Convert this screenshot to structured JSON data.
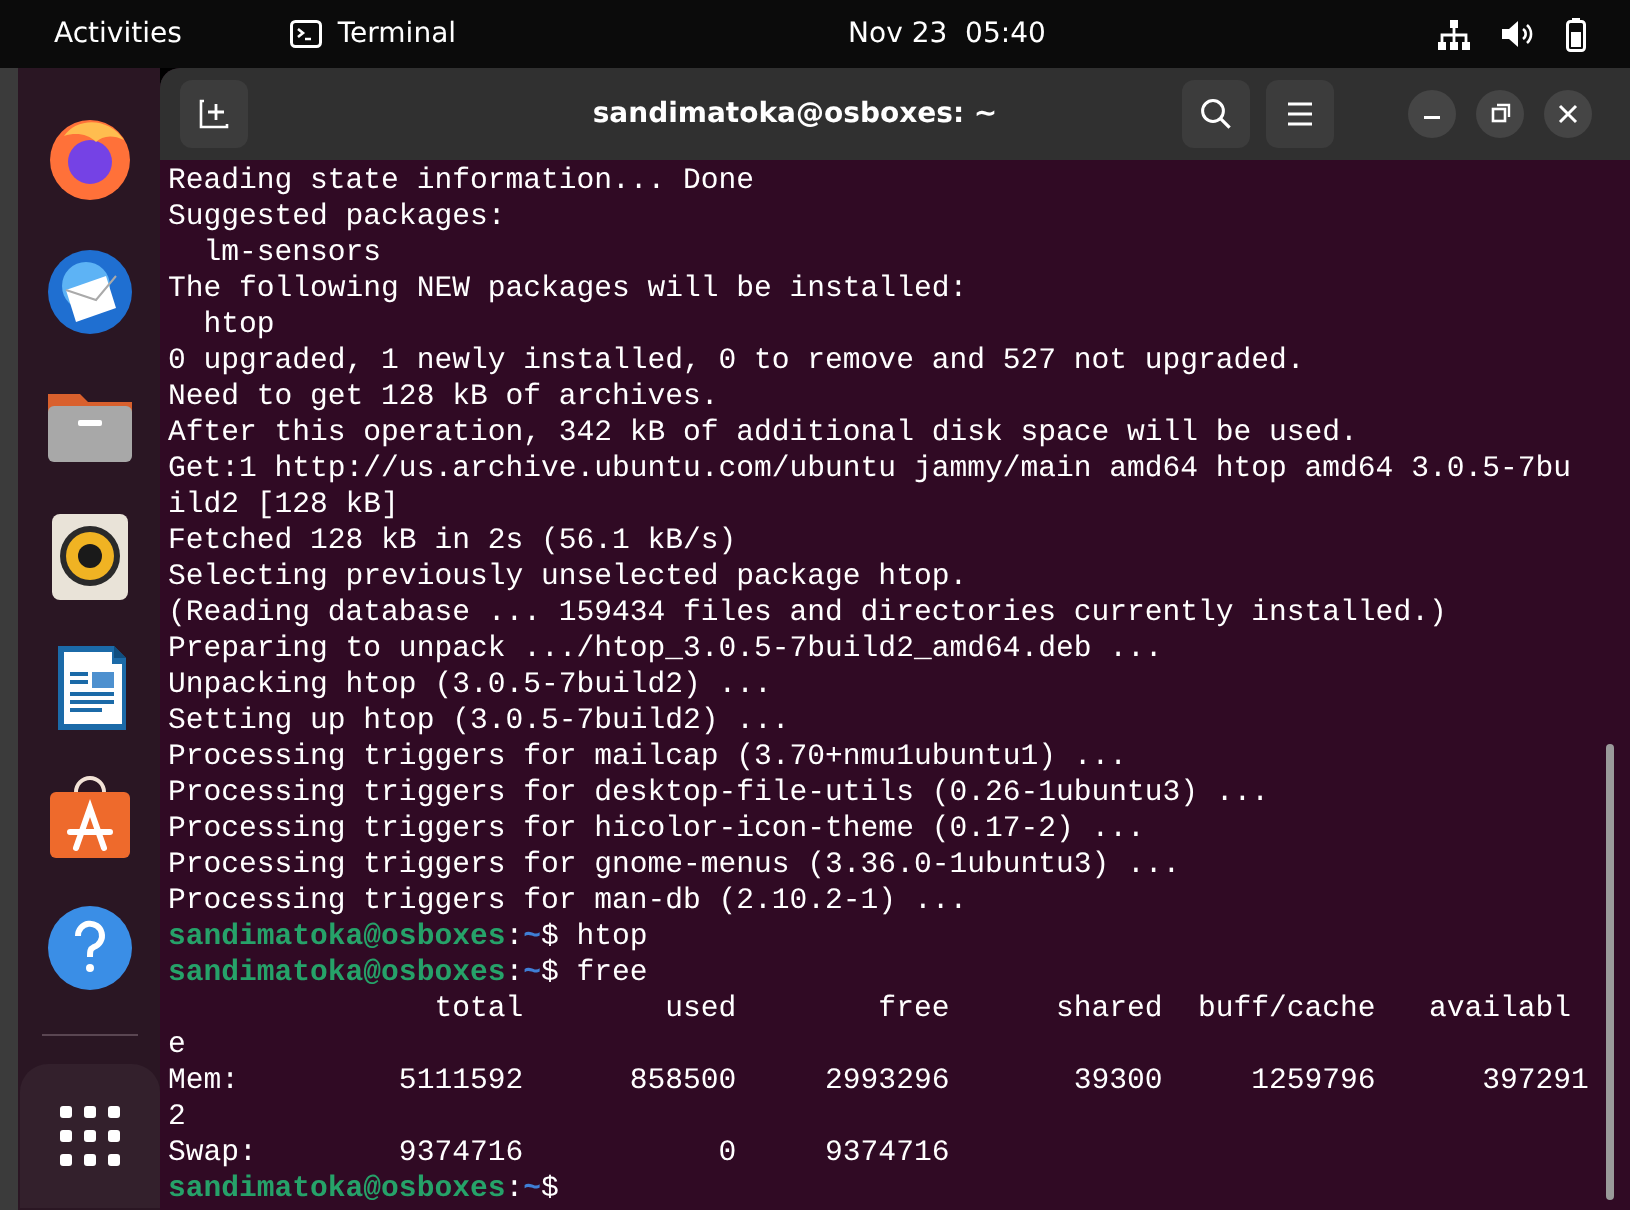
{
  "top_bar": {
    "activities": "Activities",
    "app": "Terminal",
    "clock": "Nov 23  05:40"
  },
  "window": {
    "title": "sandimatoka@osboxes: ~"
  },
  "terminal": {
    "lines": [
      {
        "kind": "output",
        "text": "Reading state information... Done"
      },
      {
        "kind": "output",
        "text": "Suggested packages:"
      },
      {
        "kind": "output",
        "text": "  lm-sensors"
      },
      {
        "kind": "output",
        "text": "The following NEW packages will be installed:"
      },
      {
        "kind": "output",
        "text": "  htop"
      },
      {
        "kind": "output",
        "text": "0 upgraded, 1 newly installed, 0 to remove and 527 not upgraded."
      },
      {
        "kind": "output",
        "text": "Need to get 128 kB of archives."
      },
      {
        "kind": "output",
        "text": "After this operation, 342 kB of additional disk space will be used."
      },
      {
        "kind": "output",
        "text": "Get:1 http://us.archive.ubuntu.com/ubuntu jammy/main amd64 htop amd64 3.0.5-7bu"
      },
      {
        "kind": "output",
        "text": "ild2 [128 kB]"
      },
      {
        "kind": "output",
        "text": "Fetched 128 kB in 2s (56.1 kB/s)"
      },
      {
        "kind": "output",
        "text": "Selecting previously unselected package htop."
      },
      {
        "kind": "output",
        "text": "(Reading database ... 159434 files and directories currently installed.)"
      },
      {
        "kind": "output",
        "text": "Preparing to unpack .../htop_3.0.5-7build2_amd64.deb ..."
      },
      {
        "kind": "output",
        "text": "Unpacking htop (3.0.5-7build2) ..."
      },
      {
        "kind": "output",
        "text": "Setting up htop (3.0.5-7build2) ..."
      },
      {
        "kind": "output",
        "text": "Processing triggers for mailcap (3.70+nmu1ubuntu1) ..."
      },
      {
        "kind": "output",
        "text": "Processing triggers for desktop-file-utils (0.26-1ubuntu3) ..."
      },
      {
        "kind": "output",
        "text": "Processing triggers for hicolor-icon-theme (0.17-2) ..."
      },
      {
        "kind": "output",
        "text": "Processing triggers for gnome-menus (3.36.0-1ubuntu3) ..."
      },
      {
        "kind": "output",
        "text": "Processing triggers for man-db (2.10.2-1) ..."
      },
      {
        "kind": "prompt",
        "user": "sandimatoka@osboxes",
        "separator": ":",
        "path": "~",
        "symbol": "$",
        "command": "htop"
      },
      {
        "kind": "prompt",
        "user": "sandimatoka@osboxes",
        "separator": ":",
        "path": "~",
        "symbol": "$",
        "command": "free"
      },
      {
        "kind": "output",
        "text": "               total        used        free      shared  buff/cache   availabl"
      },
      {
        "kind": "output",
        "text": "e"
      },
      {
        "kind": "output",
        "text": "Mem:         5111592      858500     2993296       39300     1259796      397291"
      },
      {
        "kind": "output",
        "text": "2"
      },
      {
        "kind": "output",
        "text": "Swap:        9374716           0     9374716"
      },
      {
        "kind": "prompt",
        "user": "sandimatoka@osboxes",
        "separator": ":",
        "path": "~",
        "symbol": "$"
      }
    ]
  }
}
